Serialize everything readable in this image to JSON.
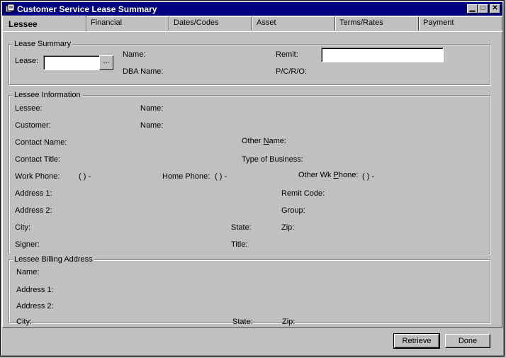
{
  "window": {
    "title": "Customer Service Lease Summary",
    "controls": {
      "minimize": "▁",
      "maximize": "□",
      "close": "✕"
    }
  },
  "tabs": [
    "Lessee",
    "Financial",
    "Dates/Codes",
    "Asset",
    "Terms/Rates",
    "Payment"
  ],
  "lease_summary": {
    "legend": "Lease Summary",
    "lease_label": "Lease:",
    "lease_value": "",
    "ellipsis": "...",
    "name_label": "Name:",
    "dba_label": "DBA Name:",
    "remit_label": "Remit:",
    "remit_value": "",
    "pcro_label": "P/C/R/O:"
  },
  "lessee_info": {
    "legend": "Lessee Information",
    "lessee_label": "Lessee:",
    "lessee_name_label": "Name:",
    "customer_label": "Customer:",
    "customer_name_label": "Name:",
    "contact_name_label": "Contact Name:",
    "other_name_label_pre": "Other ",
    "other_name_label_ul": "N",
    "other_name_label_post": "ame:",
    "contact_title_label": "Contact Title:",
    "type_business_label": "Type of Business:",
    "work_phone_label": "Work Phone:",
    "work_phone_value": "(   )   -",
    "home_phone_label": "Home Phone:",
    "home_phone_value": "(   )   -",
    "other_wk_phone_label_pre": "Other Wk ",
    "other_wk_phone_label_ul": "P",
    "other_wk_phone_label_post": "hone:",
    "other_wk_phone_value": "(   )   -",
    "address1_label": "Address 1:",
    "remit_code_label": "Remit Code:",
    "address2_label": "Address 2:",
    "group_label": "Group:",
    "city_label": "City:",
    "state_label": "State:",
    "zip_label": "Zip:",
    "signer_label": "Signer:",
    "title_label": "Title:"
  },
  "billing_address": {
    "legend": "Lessee Billing Address",
    "name_label": "Name:",
    "address1_label": "Address 1:",
    "address2_label": "Address 2:",
    "city_label": "City:",
    "state_label": "State:",
    "zip_label": "Zip:"
  },
  "buttons": {
    "retrieve": "Retrieve",
    "done": "Done"
  },
  "colors": {
    "titlebar": "#000080",
    "face": "#c0c0c0",
    "field": "#ffffff"
  }
}
